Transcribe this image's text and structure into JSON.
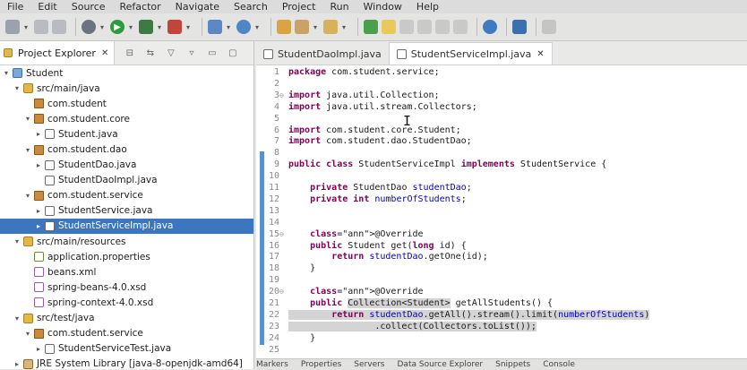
{
  "menu": [
    "File",
    "Edit",
    "Source",
    "Refactor",
    "Navigate",
    "Search",
    "Project",
    "Run",
    "Window",
    "Help"
  ],
  "explorer": {
    "title": "Project Explorer",
    "close": "✕",
    "tree": [
      {
        "label": "Student",
        "icon": "project",
        "indent": 0,
        "arrow": "▾"
      },
      {
        "label": "src/main/java",
        "icon": "folder",
        "indent": 1,
        "arrow": "▾"
      },
      {
        "label": "com.student",
        "icon": "package",
        "indent": 2,
        "arrow": ""
      },
      {
        "label": "com.student.core",
        "icon": "package",
        "indent": 2,
        "arrow": "▾"
      },
      {
        "label": "Student.java",
        "icon": "java",
        "indent": 3,
        "arrow": "▸"
      },
      {
        "label": "com.student.dao",
        "icon": "package",
        "indent": 2,
        "arrow": "▾"
      },
      {
        "label": "StudentDao.java",
        "icon": "java",
        "indent": 3,
        "arrow": "▸"
      },
      {
        "label": "StudentDaoImpl.java",
        "icon": "java",
        "indent": 3,
        "arrow": ""
      },
      {
        "label": "com.student.service",
        "icon": "package",
        "indent": 2,
        "arrow": "▾"
      },
      {
        "label": "StudentService.java",
        "icon": "java",
        "indent": 3,
        "arrow": "▸"
      },
      {
        "label": "StudentServiceImpl.java",
        "icon": "java",
        "indent": 3,
        "arrow": "▸",
        "selected": true
      },
      {
        "label": "src/main/resources",
        "icon": "folder",
        "indent": 1,
        "arrow": "▾"
      },
      {
        "label": "application.properties",
        "icon": "props",
        "indent": 2,
        "arrow": ""
      },
      {
        "label": "beans.xml",
        "icon": "xml",
        "indent": 2,
        "arrow": ""
      },
      {
        "label": "spring-beans-4.0.xsd",
        "icon": "xml",
        "indent": 2,
        "arrow": ""
      },
      {
        "label": "spring-context-4.0.xsd",
        "icon": "xml",
        "indent": 2,
        "arrow": ""
      },
      {
        "label": "src/test/java",
        "icon": "folder",
        "indent": 1,
        "arrow": "▾"
      },
      {
        "label": "com.student.service",
        "icon": "package",
        "indent": 2,
        "arrow": "▾"
      },
      {
        "label": "StudentServiceTest.java",
        "icon": "java",
        "indent": 3,
        "arrow": "▸"
      },
      {
        "label": "JRE System Library [java-8-openjdk-amd64]",
        "icon": "library",
        "indent": 1,
        "arrow": "▸"
      }
    ]
  },
  "editor": {
    "tabs": [
      {
        "label": "StudentDaoImpl.java",
        "active": false
      },
      {
        "label": "StudentServiceImpl.java",
        "active": true,
        "close": "✕"
      }
    ],
    "lines": [
      {
        "n": "1",
        "text": "package com.student.service;"
      },
      {
        "n": "2",
        "text": ""
      },
      {
        "n": "3",
        "text": "import java.util.Collection;",
        "fold": "⊖"
      },
      {
        "n": "4",
        "text": "import java.util.stream.Collectors;"
      },
      {
        "n": "5",
        "text": ""
      },
      {
        "n": "6",
        "text": "import com.student.core.Student;"
      },
      {
        "n": "7",
        "text": "import com.student.dao.StudentDao;"
      },
      {
        "n": "8",
        "text": ""
      },
      {
        "n": "9",
        "text": "public class StudentServiceImpl implements StudentService {"
      },
      {
        "n": "10",
        "text": ""
      },
      {
        "n": "11",
        "text": "    private StudentDao studentDao;"
      },
      {
        "n": "12",
        "text": "    private int numberOfStudents;"
      },
      {
        "n": "13",
        "text": ""
      },
      {
        "n": "14",
        "text": ""
      },
      {
        "n": "15",
        "text": "    @Override",
        "fold": "⊖"
      },
      {
        "n": "16",
        "text": "    public Student get(long id) {"
      },
      {
        "n": "17",
        "text": "        return studentDao.getOne(id);"
      },
      {
        "n": "18",
        "text": "    }"
      },
      {
        "n": "19",
        "text": ""
      },
      {
        "n": "20",
        "text": "    @Override",
        "fold": "⊖"
      },
      {
        "n": "21",
        "text": "    public Collection<Student> getAllStudents() {"
      },
      {
        "n": "22",
        "text": "        return studentDao.getAll().stream().limit(numberOfStudents)"
      },
      {
        "n": "23",
        "text": "                .collect(Collectors.toList());"
      },
      {
        "n": "24",
        "text": "    }"
      },
      {
        "n": "25",
        "text": ""
      }
    ]
  },
  "bottom_tabs": [
    "Markers",
    "Properties",
    "Servers",
    "Data Source Explorer",
    "Snippets",
    "Console"
  ],
  "colors": {
    "selection": "#3b76bf",
    "keyword": "#7f0055",
    "field": "#0000c0",
    "annotation": "#646464"
  }
}
